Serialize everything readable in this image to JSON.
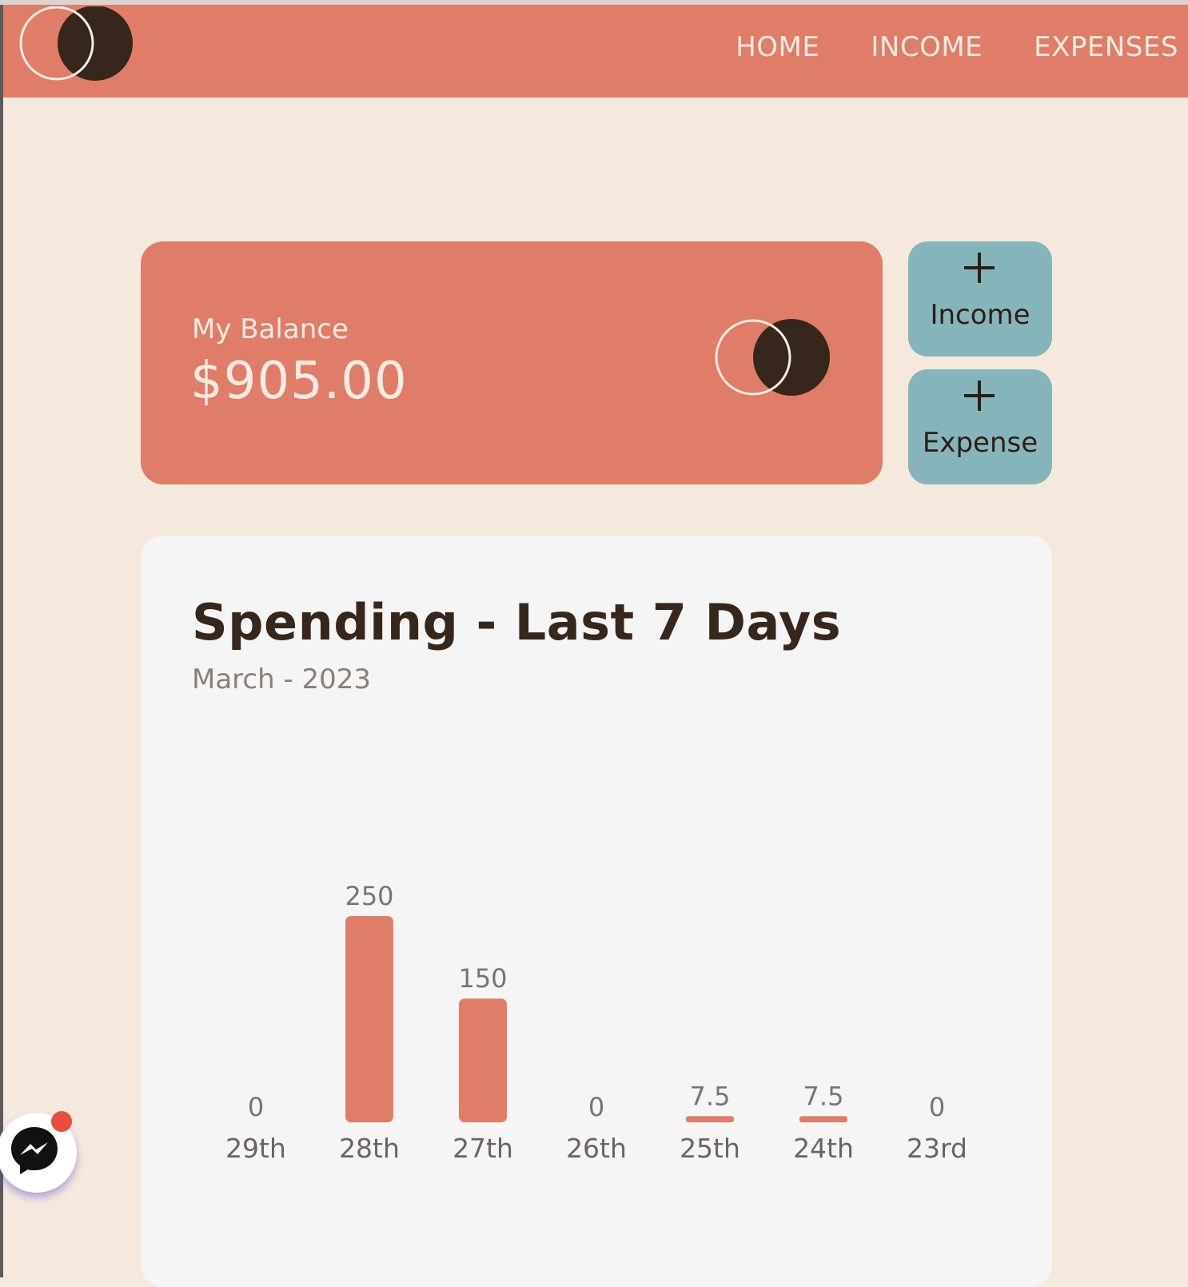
{
  "colors": {
    "accent": "#e07d68",
    "background": "#f5e9de",
    "dark": "#36261b",
    "button": "#85b5bb",
    "card": "#f5f5f5"
  },
  "nav": {
    "logo_icon": "double-circle-logo",
    "links": [
      "HOME",
      "INCOME",
      "EXPENSES"
    ]
  },
  "balance": {
    "label": "My Balance",
    "amount": "$905.00",
    "logo_icon": "double-circle-logo"
  },
  "actions": {
    "income": {
      "icon": "plus-icon",
      "label": "Income"
    },
    "expense": {
      "icon": "plus-icon",
      "label": "Expense"
    }
  },
  "spending": {
    "title": "Spending - Last 7 Days",
    "subtitle": "March - 2023"
  },
  "chart_data": {
    "type": "bar",
    "title": "Spending - Last 7 Days",
    "subtitle": "March - 2023",
    "categories": [
      "29th",
      "28th",
      "27th",
      "26th",
      "25th",
      "24th",
      "23rd"
    ],
    "values": [
      0,
      250,
      150,
      0,
      7.5,
      7.5,
      0
    ],
    "value_labels": [
      "0",
      "250",
      "150",
      "0",
      "7.5",
      "7.5",
      "0"
    ],
    "xlabel": "",
    "ylabel": "",
    "ylim": [
      0,
      250
    ],
    "grid": false,
    "bar_color": "#e07d68"
  },
  "messenger": {
    "icon": "messenger-icon",
    "badge_icon": "notification-dot-icon"
  }
}
